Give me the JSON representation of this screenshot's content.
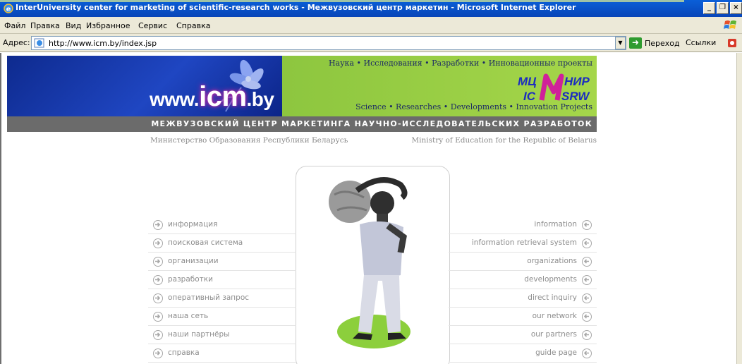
{
  "window": {
    "title": "InterUniversity center for marketing of scientific-research works - Межвузовский центр маркетин - Microsoft Internet Explorer",
    "buttons": [
      "_",
      "❐",
      "×"
    ]
  },
  "menu": {
    "items": [
      "Файл",
      "Правка",
      "Вид",
      "Избранное",
      "Сервис",
      "Справка"
    ]
  },
  "address": {
    "label": "Адрес:",
    "url": "http://www.icm.by/index.jsp",
    "go_label": "Переход",
    "links_label": "Ссылки"
  },
  "banner": {
    "logo_prefix": "www.",
    "logo_main": "icm",
    "logo_suffix": ".by",
    "tagline_ru": "Наука • Исследования • Разработки • Инновационные проекты",
    "tagline_en": "Science • Researches • Developments • Innovation Projects",
    "brand_ru_left": "МЦ",
    "brand_ru_right": "НИР",
    "brand_en_left": "IC",
    "brand_en_right": "SRW",
    "subtitle": "МЕЖВУЗОВСКИЙ ЦЕНТР МАРКЕТИНГА НАУЧНО-ИССЛЕДОВАТЕЛЬСКИХ РАЗРАБОТОК",
    "ministry_ru": "Министерство Образования Республики Беларусь",
    "ministry_en": "Ministry of Education for the Republic of Belarus"
  },
  "nav_ru": [
    "информация",
    "поисковая система",
    "организации",
    "разработки",
    "оперативный запрос",
    "наша сеть",
    "наши партнёры",
    "справка"
  ],
  "nav_en": [
    "information",
    "information retrieval system",
    "organizations",
    "developments",
    "direct inquiry",
    "our network",
    "our partners",
    "guide page"
  ],
  "colors": {
    "banner_blue": "#1f46c2",
    "banner_green": "#a5d64a",
    "subtitle_band": "#6b6b6b",
    "nav_text": "#8c8c8c"
  }
}
